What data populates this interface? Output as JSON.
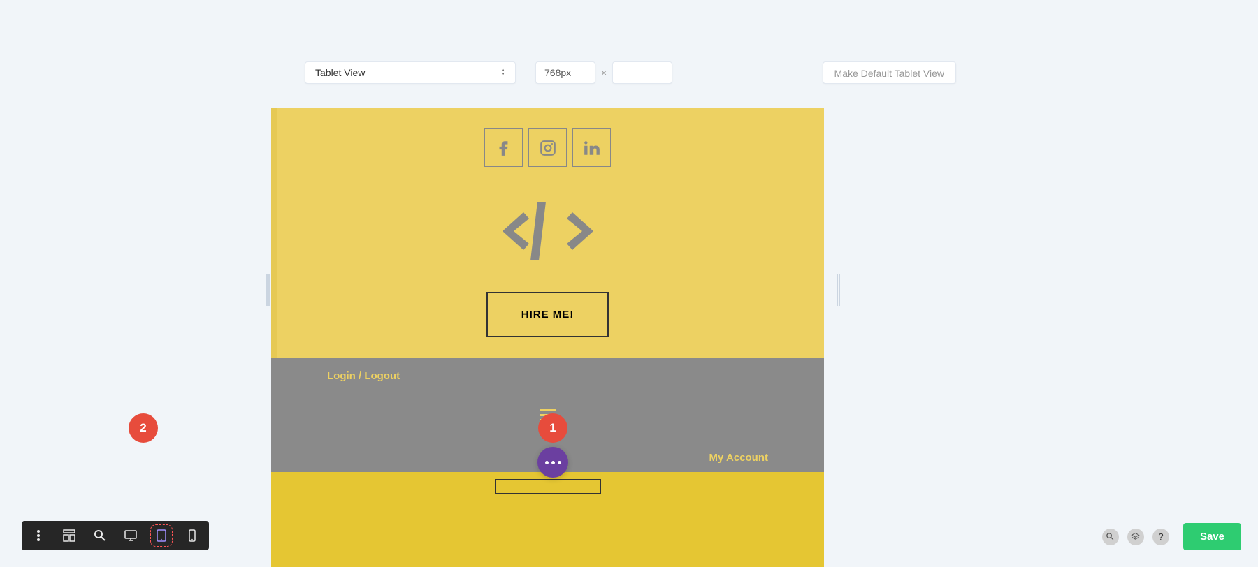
{
  "top_controls": {
    "view_select_label": "Tablet View",
    "width_value": "768px",
    "height_value": "",
    "make_default_label": "Make Default Tablet View"
  },
  "preview": {
    "hire_button_label": "HIRE ME!",
    "login_link_label": "Login / Logout",
    "account_link_label": "My Account"
  },
  "badges": {
    "badge_1": "1",
    "badge_2": "2"
  },
  "bottom_right": {
    "save_label": "Save",
    "help_label": "?"
  }
}
